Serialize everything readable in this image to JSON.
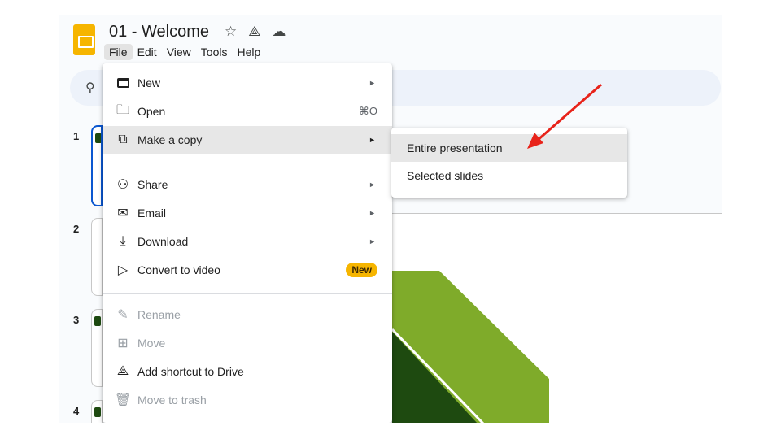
{
  "document": {
    "title": "01 - Welcome",
    "title_icons": [
      "star-icon",
      "drive-shortcut-icon",
      "cloud-saved-icon"
    ]
  },
  "menubar": [
    "File",
    "Edit",
    "View",
    "Tools",
    "Help"
  ],
  "slide_numbers": [
    "1",
    "2",
    "3",
    "4"
  ],
  "file_menu": {
    "items": [
      {
        "label": "New",
        "icon": "presentation-icon",
        "arrow": "►"
      },
      {
        "label": "Open",
        "icon": "folder-icon",
        "shortcut": "⌘O"
      },
      {
        "label": "Make a copy",
        "icon": "copy-icon",
        "arrow": "►"
      },
      {
        "label": "Share",
        "icon": "person-add-icon",
        "arrow": "►"
      },
      {
        "label": "Email",
        "icon": "mail-icon",
        "arrow": "►"
      },
      {
        "label": "Download",
        "icon": "download-icon",
        "arrow": "►"
      },
      {
        "label": "Convert to video",
        "icon": "play-sparkle-icon",
        "badge": "New"
      },
      {
        "label": "Rename",
        "icon": "pencil-icon",
        "disabled": true
      },
      {
        "label": "Move",
        "icon": "move-folder-icon",
        "disabled": true
      },
      {
        "label": "Add shortcut to Drive",
        "icon": "drive-shortcut-icon"
      },
      {
        "label": "Move to trash",
        "icon": "trash-icon",
        "disabled": true
      }
    ]
  },
  "copy_submenu": {
    "items": [
      "Entire presentation",
      "Selected slides"
    ]
  },
  "colors": {
    "highlight": "#e7e7e7",
    "annotation_arrow": "#e8231a",
    "slide_green_light": "#7fab2a",
    "slide_green_dark": "#1e4a10",
    "badge": "#f6b500"
  }
}
